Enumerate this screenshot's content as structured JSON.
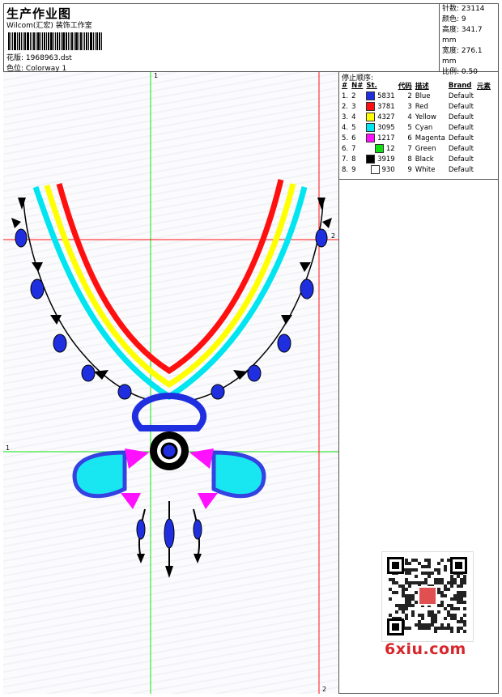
{
  "header": {
    "title": "生产作业图",
    "studio": "Wilcom(汇宏) 装饰工作室",
    "pattern_label": "花版:",
    "pattern_value": "1968963.dst",
    "colorway_label": "色位:",
    "colorway_value": "Colorway 1"
  },
  "stats": {
    "stitches": "针数: 23114",
    "colors": "颜色: 9",
    "height": "高度: 341.7 mm",
    "width": "宽度: 276.1 mm",
    "scale": "比例: 0.50"
  },
  "stop_sequence": {
    "title": "停止顺序:",
    "headers": [
      "#",
      "N#",
      "St.",
      "代码",
      "描述",
      "Brand",
      "元素"
    ],
    "rows": [
      {
        "idx": "1.",
        "n": "2",
        "st": "5831",
        "code": "2",
        "desc": "Blue",
        "brand": "Default",
        "color": "#1f2fe0"
      },
      {
        "idx": "2.",
        "n": "3",
        "st": "3781",
        "code": "3",
        "desc": "Red",
        "brand": "Default",
        "color": "#ff1010"
      },
      {
        "idx": "3.",
        "n": "4",
        "st": "4327",
        "code": "4",
        "desc": "Yellow",
        "brand": "Default",
        "color": "#ffff00"
      },
      {
        "idx": "4.",
        "n": "5",
        "st": "3095",
        "code": "5",
        "desc": "Cyan",
        "brand": "Default",
        "color": "#00e5f0"
      },
      {
        "idx": "5.",
        "n": "6",
        "st": "1217",
        "code": "6",
        "desc": "Magenta",
        "brand": "Default",
        "color": "#ff10ff"
      },
      {
        "idx": "6.",
        "n": "7",
        "st": "12",
        "code": "7",
        "desc": "Green",
        "brand": "Default",
        "color": "#10e010"
      },
      {
        "idx": "7.",
        "n": "8",
        "st": "3919",
        "code": "8",
        "desc": "Black",
        "brand": "Default",
        "color": "#000000"
      },
      {
        "idx": "8.",
        "n": "9",
        "st": "930",
        "code": "9",
        "desc": "White",
        "brand": "Default",
        "color": "#ffffff"
      }
    ]
  },
  "guides": {
    "v1": "1",
    "v2": "2",
    "h1": "1",
    "h2": "2"
  },
  "watermark": "6xiu.com",
  "colors": {
    "blue": "#1f2fe0",
    "red": "#ff1010",
    "yellow": "#ffff00",
    "cyan": "#00e5f0",
    "magenta": "#ff10ff",
    "green": "#10e010",
    "black": "#000000"
  }
}
